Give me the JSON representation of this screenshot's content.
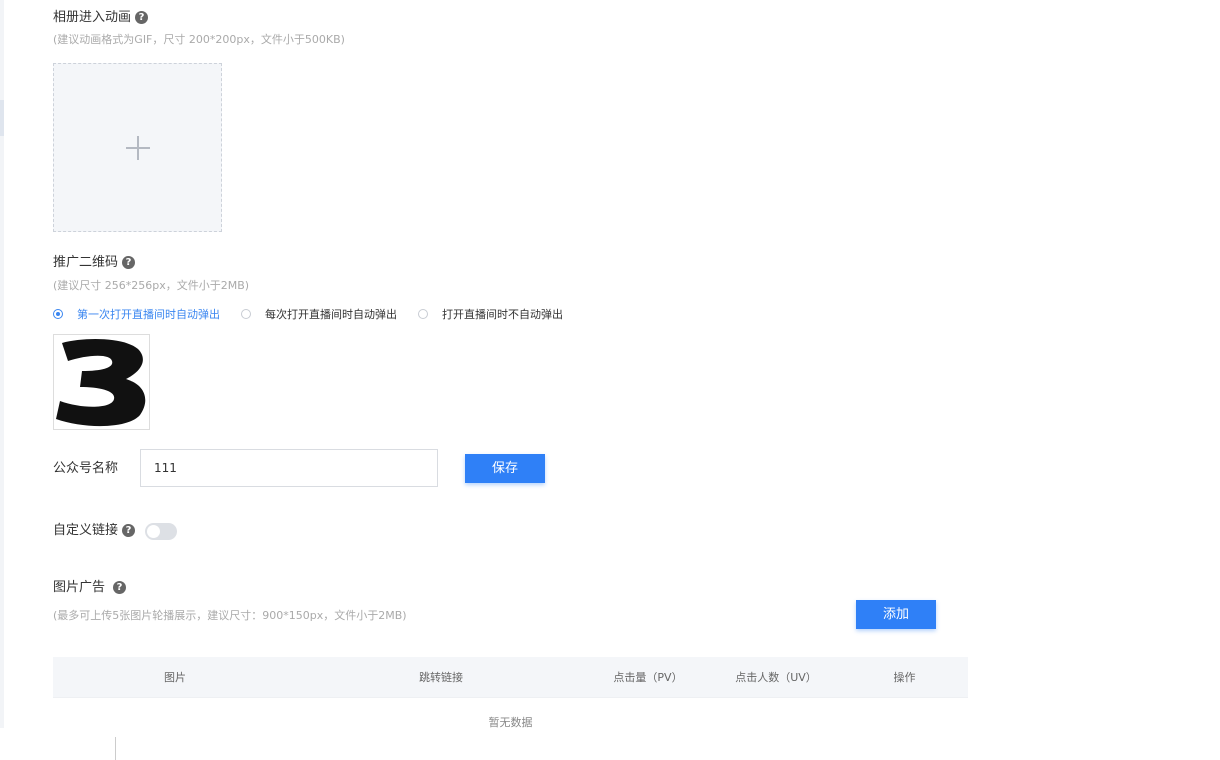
{
  "album_animation": {
    "title": "相册进入动画",
    "help_icon": "?",
    "hint": "(建议动画格式为GIF，尺寸 200*200px，文件小于500KB)",
    "upload_icon": "plus-icon"
  },
  "qrcode": {
    "title": "推广二维码",
    "help_icon": "?",
    "hint": "(建议尺寸 256*256px，文件小于2MB)",
    "options": [
      {
        "label": "第一次打开直播间时自动弹出",
        "selected": true
      },
      {
        "label": "每次打开直播间时自动弹出",
        "selected": false
      },
      {
        "label": "打开直播间时不自动弹出",
        "selected": false
      }
    ],
    "image_glyph": "3"
  },
  "account": {
    "label": "公众号名称",
    "value": "111",
    "save_label": "保存"
  },
  "custom_link": {
    "label": "自定义链接",
    "help_icon": "?",
    "enabled": false
  },
  "image_ad": {
    "title": "图片广告",
    "help_icon": "?",
    "hint": "(最多可上传5张图片轮播展示，建议尺寸：900*150px，文件小于2MB)",
    "add_label": "添加",
    "columns": [
      "图片",
      "跳转链接",
      "点击量（PV）",
      "点击人数（UV）",
      "操作"
    ],
    "empty_text": "暂无数据"
  },
  "colors": {
    "primary": "#2f80f7",
    "selected_radio": "#3a86f0"
  }
}
